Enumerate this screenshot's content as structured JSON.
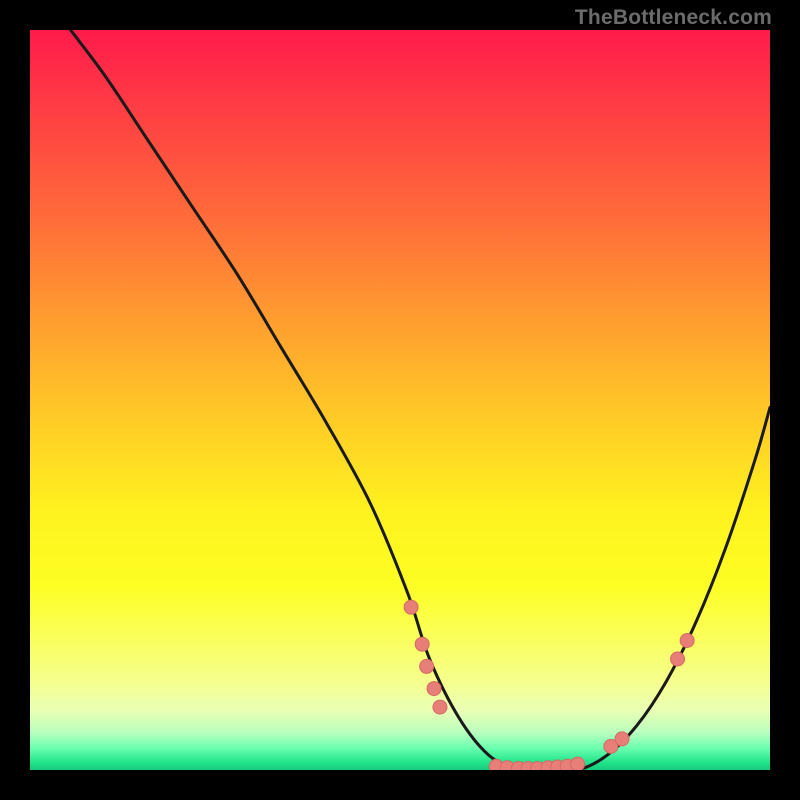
{
  "watermark": "TheBottleneck.com",
  "colors": {
    "background": "#000000",
    "curve_stroke": "#1a1a1a",
    "point_fill": "#e77f78",
    "point_stroke": "#d46a63"
  },
  "chart_data": {
    "type": "line",
    "title": "",
    "xlabel": "",
    "ylabel": "",
    "xlim": [
      0,
      100
    ],
    "ylim": [
      0,
      100
    ],
    "grid": false,
    "legend": false,
    "series": [
      {
        "name": "bottleneck-curve",
        "x": [
          0,
          4,
          10,
          16,
          22,
          28,
          34,
          40,
          46,
          51,
          54,
          58,
          62,
          66,
          70,
          74,
          78,
          82,
          86,
          90,
          94,
          98,
          100
        ],
        "y": [
          108,
          102,
          94,
          85,
          76,
          67,
          57,
          47,
          36,
          24,
          15,
          7,
          2,
          0,
          0,
          0,
          2,
          6,
          12,
          20,
          30,
          42,
          49
        ]
      }
    ],
    "points": [
      {
        "x": 51.5,
        "y": 22
      },
      {
        "x": 53.0,
        "y": 17
      },
      {
        "x": 53.6,
        "y": 14
      },
      {
        "x": 54.6,
        "y": 11
      },
      {
        "x": 55.4,
        "y": 8.5
      },
      {
        "x": 63.0,
        "y": 0.5
      },
      {
        "x": 64.5,
        "y": 0.3
      },
      {
        "x": 66.0,
        "y": 0.2
      },
      {
        "x": 67.3,
        "y": 0.2
      },
      {
        "x": 68.6,
        "y": 0.2
      },
      {
        "x": 70.0,
        "y": 0.3
      },
      {
        "x": 71.3,
        "y": 0.4
      },
      {
        "x": 72.6,
        "y": 0.5
      },
      {
        "x": 74.0,
        "y": 0.8
      },
      {
        "x": 78.5,
        "y": 3.2
      },
      {
        "x": 80.0,
        "y": 4.2
      },
      {
        "x": 87.5,
        "y": 15
      },
      {
        "x": 88.8,
        "y": 17.5
      }
    ],
    "notes": "x is relative horizontal position (0–100), y is relative bottleneck magnitude (0=bottom/green, 100=top/red). Curve descends steeply from upper-left, bottoms out ~x=64–74, then rises toward the right."
  }
}
